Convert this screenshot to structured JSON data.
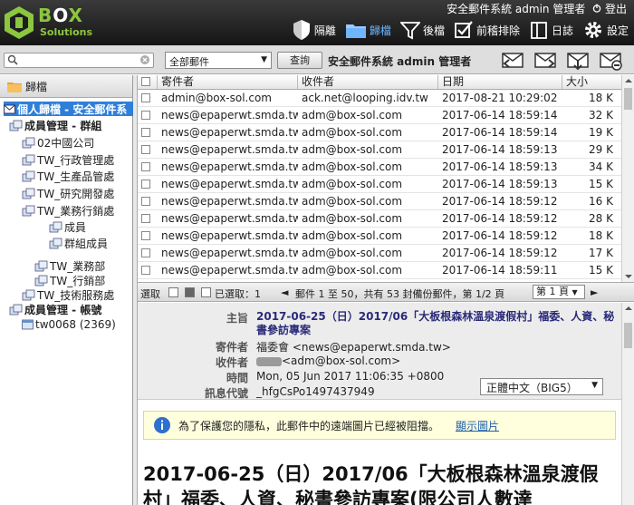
{
  "brand": {
    "name_box": "B",
    "name_o": "O",
    "name_x": "X",
    "subtitle": "Solutions"
  },
  "header": {
    "user_line": "安全郵件系統 admin 管理者",
    "logout": "登出",
    "toolbar": [
      {
        "label": "隔離",
        "icon": "shield-icon"
      },
      {
        "label": "歸檔",
        "icon": "archive-icon"
      },
      {
        "label": "後檔",
        "icon": "filter-icon"
      },
      {
        "label": "前稽排除",
        "icon": "checkbox-icon"
      },
      {
        "label": "日誌",
        "icon": "log-icon"
      },
      {
        "label": "設定",
        "icon": "gear-icon"
      }
    ]
  },
  "searchbar": {
    "search_placeholder": "",
    "scope_selected": "全部郵件",
    "query_label": "查詢",
    "scope_title": "安全郵件系統 admin 管理者"
  },
  "sidebar": {
    "title": "歸檔",
    "tree": [
      {
        "label": "個人歸檔 - 安全郵件系",
        "icon": "mailbox-icon"
      },
      {
        "label": "成員管理 - 群組",
        "icon": "group-icon"
      },
      {
        "label": "02中國公司",
        "icon": "group-icon"
      },
      {
        "label": "TW_行政管理處",
        "icon": "group-icon"
      },
      {
        "label": "TW_生產品管處",
        "icon": "group-icon"
      },
      {
        "label": "TW_研究開發處",
        "icon": "group-icon"
      },
      {
        "label": "TW_業務行銷處",
        "icon": "group-icon"
      },
      {
        "label": "成員",
        "icon": "group-icon"
      },
      {
        "label": "群組成員",
        "icon": "group-icon"
      },
      {
        "label": "TW_業務部",
        "icon": "group-icon"
      },
      {
        "label": "TW_行銷部",
        "icon": "group-icon"
      },
      {
        "label": "TW_技術服務處",
        "icon": "group-icon"
      },
      {
        "label": "成員管理 - 帳號",
        "icon": "group-icon"
      },
      {
        "label": "tw0068 (2369)",
        "icon": "user-icon"
      }
    ]
  },
  "maillist": {
    "columns": {
      "from": "寄件者",
      "to": "收件者",
      "date": "日期",
      "size": "大小"
    },
    "rows": [
      {
        "from": "admin@box-sol.com",
        "to": "ack.net@looping.idv.tw",
        "date": "2017-08-21 10:29:02",
        "size": "18 K"
      },
      {
        "from": "news@epaperwt.smda.tw",
        "to": "adm@box-sol.com",
        "date": "2017-06-14 18:59:14",
        "size": "32 K"
      },
      {
        "from": "news@epaperwt.smda.tw",
        "to": "adm@box-sol.com",
        "date": "2017-06-14 18:59:14",
        "size": "19 K"
      },
      {
        "from": "news@epaperwt.smda.tw",
        "to": "adm@box-sol.com",
        "date": "2017-06-14 18:59:13",
        "size": "29 K"
      },
      {
        "from": "news@epaperwt.smda.tw",
        "to": "adm@box-sol.com",
        "date": "2017-06-14 18:59:13",
        "size": "34 K"
      },
      {
        "from": "news@epaperwt.smda.tw",
        "to": "adm@box-sol.com",
        "date": "2017-06-14 18:59:13",
        "size": "15 K"
      },
      {
        "from": "news@epaperwt.smda.tw",
        "to": "adm@box-sol.com",
        "date": "2017-06-14 18:59:12",
        "size": "16 K"
      },
      {
        "from": "news@epaperwt.smda.tw",
        "to": "adm@box-sol.com",
        "date": "2017-06-14 18:59:12",
        "size": "28 K"
      },
      {
        "from": "news@epaperwt.smda.tw",
        "to": "adm@box-sol.com",
        "date": "2017-06-14 18:59:12",
        "size": "18 K"
      },
      {
        "from": "news@epaperwt.smda.tw",
        "to": "adm@box-sol.com",
        "date": "2017-06-14 18:59:12",
        "size": "17 K"
      },
      {
        "from": "news@epaperwt.smda.tw",
        "to": "adm@box-sol.com",
        "date": "2017-06-14 18:59:11",
        "size": "15 K"
      }
    ]
  },
  "pager": {
    "select_label": "選取",
    "selected": "已選取：1",
    "range": "郵件 1 至 50，共有 53 封備份郵件，第 1/2 頁",
    "page_selected": "第 1 頁"
  },
  "message": {
    "labels": {
      "subject": "主旨",
      "from": "寄件者",
      "to": "收件者",
      "time": "時間",
      "msgid": "訊息代號"
    },
    "subject": "2017-06-25（日）2017/06「大板根森林溫泉渡假村」福委、人資、秘書參訪專案",
    "from": "福委會 <news@epaperwt.smda.tw>",
    "to": "<adm@box-sol.com>",
    "time": "Mon, 05 Jun 2017 11:06:35 +0800",
    "msgid": "_hfgCsPo1497437949",
    "encoding": "正體中文（BIG5）",
    "notice": "為了保護您的隱私，此郵件中的遠端圖片已經被阻擋。",
    "show_images": "顯示圖片",
    "body_title": "2017-06-25（日）2017/06「大板根森林溫泉渡假村」福委、人資、秘書參訪專案(限公司人數達"
  }
}
